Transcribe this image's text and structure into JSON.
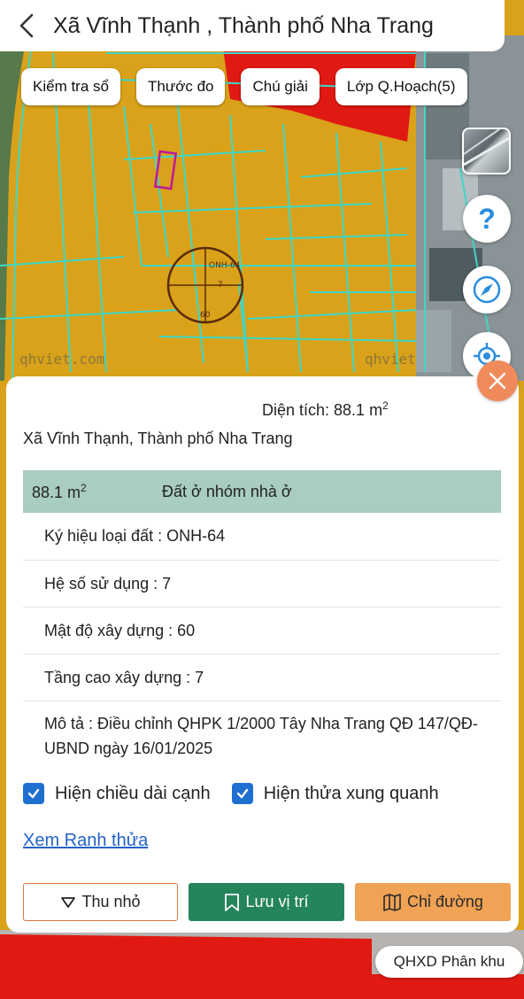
{
  "header": {
    "title": "Xã Vĩnh Thạnh , Thành phố Nha Trang"
  },
  "toolbar": {
    "buttons": [
      "Kiểm tra sổ",
      "Thước đo",
      "Chú giải",
      "Lớp Q.Hoạch(5)"
    ]
  },
  "map": {
    "watermark_left": "qhviet.com",
    "watermark_right": "qhviet",
    "parcel_labels": [
      "ONH-64",
      "7",
      "60"
    ],
    "colors": {
      "residential": "#d9a21a",
      "public": "#e01a12",
      "lines": "#3fd6c6"
    }
  },
  "right_controls": {
    "help_icon": "question-icon",
    "compass_icon": "compass-icon",
    "locate_icon": "locate-icon"
  },
  "panel": {
    "area_label": "Diện tích: 88.1 m",
    "area_sup": "2",
    "location": "Xã Vĩnh Thạnh, Thành phố Nha Trang",
    "land_area": "88.1 m",
    "land_area_sup": "2",
    "land_type": "Đất ở nhóm nhà ở",
    "rows": [
      "Ký hiệu loại đất : ONH-64",
      "Hệ số sử dụng : 7",
      "Mật độ xây dựng : 60",
      "Tầng cao xây dựng : 7",
      "Mô tả : Điều chỉnh QHPK 1/2000 Tây Nha Trang QĐ 147/QĐ-UBND ngày 16/01/2025"
    ],
    "checkbox_edges": "Hiện chiều dài cạnh",
    "checkbox_neighbors": "Hiện thửa xung quanh",
    "link": "Xem Ranh thửa",
    "btn_minimize": "Thu nhỏ",
    "btn_save": "Lưu vị trí",
    "btn_directions": "Chỉ đường"
  },
  "badge": "QHXD Phân khu"
}
